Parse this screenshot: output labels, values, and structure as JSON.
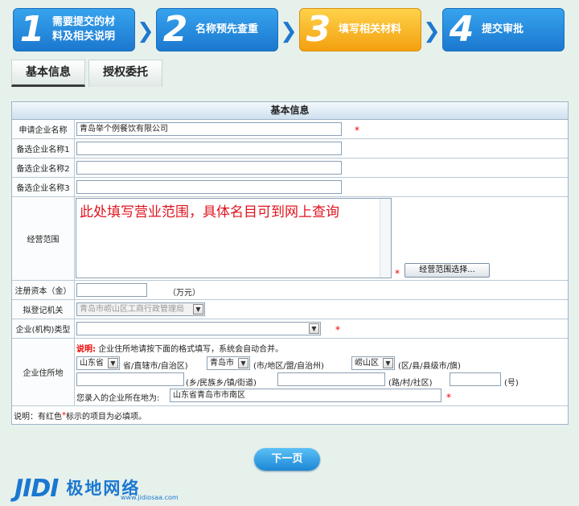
{
  "steps": [
    {
      "num": "1",
      "label": "需要提交的材\n料及相关说明"
    },
    {
      "num": "2",
      "label": "名称预先查重"
    },
    {
      "num": "3",
      "label": "填写相关材料"
    },
    {
      "num": "4",
      "label": "提交审批"
    }
  ],
  "tabs": [
    "基本信息",
    "授权委托"
  ],
  "form": {
    "header": "基本信息",
    "labels": {
      "company_name": "申请企业名称",
      "alt1": "备选企业名称1",
      "alt2": "备选企业名称2",
      "alt3": "备选企业名称3",
      "scope": "经营范围",
      "capital": "注册资本（金）",
      "authority": "拟登记机关",
      "type": "企业(机构)类型",
      "address": "企业住所地"
    },
    "company_name_value": "青岛举个例餐饮有限公司",
    "scope_hint": "此处填写营业范围，具体名目可到网上查询",
    "scope_button": "经营范围选择...",
    "capital_unit": "（万元）",
    "authority_value": "青岛市崂山区工商行政管理局",
    "address_note_title": "说明:",
    "address_note": "企业住所地请按下面的格式填写，系统会自动合并。",
    "province": "山东省",
    "province_unit": "省/直辖市/自治区)",
    "city": "青岛市",
    "city_unit": "(市/地区/盟/自治州)",
    "district": "崂山区",
    "district_unit": "(区/县/县级市/旗)",
    "township_unit": "(乡/民族乡/镇/街道)",
    "road_unit": "(路/村/社区)",
    "number_unit": "(号)",
    "full_address_label": "您录入的企业所在地为:",
    "full_address_value": "山东省青岛市市南区",
    "footnote_prefix": "说明：有红色",
    "footnote_star": "*",
    "footnote_suffix": "标示的项目为必填项。"
  },
  "next_button": "下一页",
  "logo": {
    "mark": "JIDI",
    "name": "极地网络",
    "url": "www.jidiosaa.com"
  },
  "required_mark": "*",
  "colors": {
    "step_blue": "#1b78cf",
    "step_active": "#f3a010",
    "required": "#e00000"
  }
}
